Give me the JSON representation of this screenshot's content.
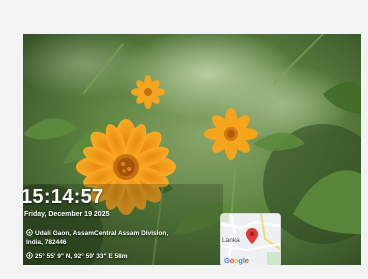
{
  "overlay": {
    "time": "15:14:57",
    "date": "Friday, December 19  2025",
    "address_line1": "Udali Gaon, AssamCentral Assam Division,",
    "address_line2": "India, 782446",
    "coordinates": "25° 55' 9\" N, 92° 59' 33\" E   58m",
    "pin_icon": "location-pin-icon",
    "compass_icon": "compass-icon"
  },
  "map": {
    "label": "Lanka",
    "logo": "Google",
    "marker_color": "#e53935",
    "marker_icon": "map-marker-icon"
  },
  "colors": {
    "text": "#ffffff",
    "flower": "#f7a21b",
    "flower_center": "#b8620f",
    "foliage": "#4e7a34"
  }
}
